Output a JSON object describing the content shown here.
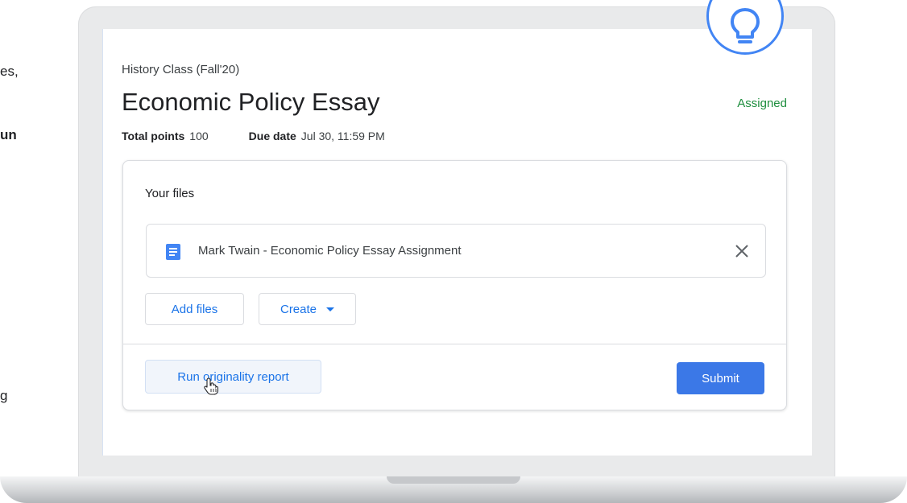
{
  "side_text": {
    "line1": "es,",
    "line2": "un",
    "line3": "g"
  },
  "assignment": {
    "class_name": "History Class (Fall'20)",
    "title": "Economic Policy Essay",
    "status": "Assigned",
    "points_label": "Total points",
    "points_value": "100",
    "due_label": "Due date",
    "due_value": "Jul 30, 11:59 PM"
  },
  "files_card": {
    "heading": "Your files",
    "file_name": "Mark Twain - Economic Policy Essay Assignment",
    "add_files_label": "Add files",
    "create_label": "Create",
    "originality_label": "Run originality report",
    "submit_label": "Submit"
  },
  "icons": {
    "badge": "lightbulb-icon",
    "file": "google-doc-icon",
    "remove": "close-icon",
    "dropdown": "caret-down-icon",
    "pointer": "hand-cursor-icon"
  },
  "colors": {
    "accent": "#1a73e8",
    "submit": "#3b78e7",
    "status": "#1e8e3e",
    "bulb": "#4285f4"
  }
}
